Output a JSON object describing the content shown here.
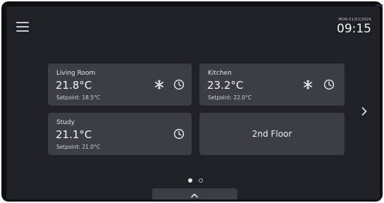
{
  "header": {
    "date": "MON 01/01/2024",
    "time": "09:15",
    "menu_icon": "hamburger-menu-icon"
  },
  "zones": [
    {
      "name": "Living Room",
      "temperature": "21.8°C",
      "setpoint": "Setpoint: 18.5°C",
      "icons": [
        "snowflake-icon",
        "clock-icon"
      ]
    },
    {
      "name": "Kitchen",
      "temperature": "23.2°C",
      "setpoint": "Setpoint: 22.0°C",
      "icons": [
        "snowflake-icon",
        "clock-icon"
      ]
    },
    {
      "name": "Study",
      "temperature": "21.1°C",
      "setpoint": "Setpoint: 21.0°C",
      "icons": [
        "clock-icon"
      ]
    }
  ],
  "floor_tile": {
    "label": "2nd Floor"
  },
  "pagination": {
    "current_page": 1,
    "total_pages": 2
  },
  "navigation": {
    "next_icon": "chevron-right-icon",
    "drawer_icon": "chevron-up-icon"
  },
  "colors": {
    "bezel": "#0d0f12",
    "background": "#1e2126",
    "tile": "#3a3e45",
    "text": "#eef0f3"
  }
}
